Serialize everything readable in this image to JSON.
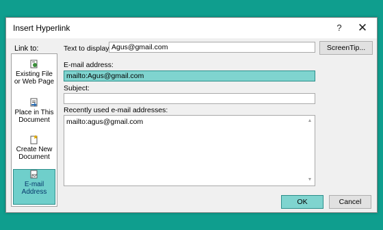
{
  "dialog": {
    "title": "Insert Hyperlink",
    "help_label": "?",
    "close_label": "✕"
  },
  "link_to": {
    "label": "Link to:",
    "items": [
      {
        "label": "Existing File\nor Web Page",
        "icon": "existing-file-icon"
      },
      {
        "label": "Place in This\nDocument",
        "icon": "place-in-document-icon"
      },
      {
        "label": "Create New\nDocument",
        "icon": "create-new-document-icon"
      },
      {
        "label": "E-mail\nAddress",
        "icon": "email-address-icon",
        "selected": true
      }
    ]
  },
  "form": {
    "text_to_display_label": "Text to display:",
    "text_to_display_value": "Agus@gmail.com",
    "screentip_label": "ScreenTip...",
    "email_address_label": "E-mail address:",
    "email_address_value": "mailto:Agus@gmail.com",
    "subject_label": "Subject:",
    "subject_value": "",
    "recent_label": "Recently used e-mail addresses:",
    "recent_items": [
      "mailto:agus@gmail.com"
    ]
  },
  "buttons": {
    "ok_label": "OK",
    "cancel_label": "Cancel"
  },
  "colors": {
    "background": "#0f9e8e",
    "accent": "#7fd4cf"
  }
}
